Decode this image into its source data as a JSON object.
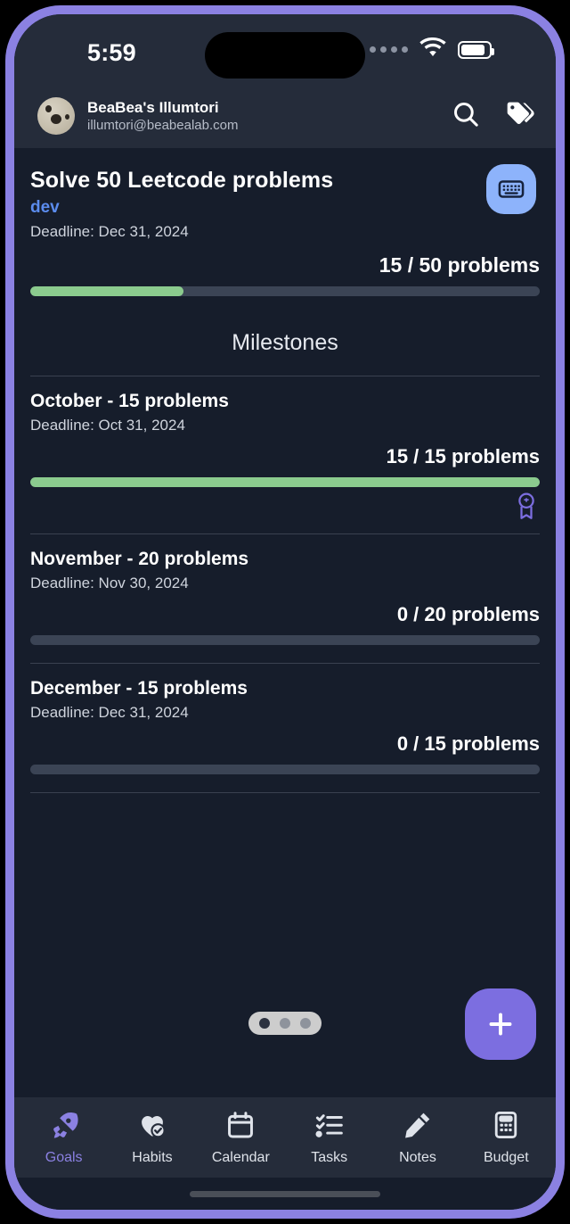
{
  "status_bar": {
    "time": "5:59",
    "signal_icon": "signal-dots-icon",
    "wifi_icon": "wifi-icon",
    "battery_icon": "battery-icon"
  },
  "account_header": {
    "name": "BeaBea's Illumtori",
    "email": "illumtori@beabealab.com",
    "avatar_icon": "avatar",
    "search_icon": "search-icon",
    "tags_icon": "tags-icon"
  },
  "goal": {
    "title": "Solve 50 Leetcode problems",
    "category": "dev",
    "deadline": "Deadline: Dec 31, 2024",
    "progress_label": "15 / 50 problems",
    "progress_percent": 30,
    "type_icon": "keyboard-icon",
    "accent_color": "#5b8cee",
    "progress_color": "#8bcb8e"
  },
  "milestones_section": {
    "title": "Milestones",
    "items": [
      {
        "name": "October - 15 problems",
        "deadline": "Deadline: Oct 31, 2024",
        "progress_label": "15 / 15 problems",
        "progress_percent": 100,
        "badge_icon": "award-medal-icon",
        "completed": true
      },
      {
        "name": "November - 20 problems",
        "deadline": "Deadline: Nov 30, 2024",
        "progress_label": "0 / 20 problems",
        "progress_percent": 0,
        "badge_icon": "",
        "completed": false
      },
      {
        "name": "December - 15 problems",
        "deadline": "Deadline: Dec 31, 2024",
        "progress_label": "0 / 15 problems",
        "progress_percent": 0,
        "badge_icon": "",
        "completed": false
      }
    ]
  },
  "page_indicator": {
    "total": 3,
    "active_index": 0
  },
  "fab": {
    "icon": "plus-icon",
    "color": "#7c6ee0"
  },
  "bottom_nav": {
    "active_color": "#8b81e2",
    "items": [
      {
        "label": "Goals",
        "icon": "rocket-icon",
        "active": true
      },
      {
        "label": "Habits",
        "icon": "heart-check-icon",
        "active": false
      },
      {
        "label": "Calendar",
        "icon": "calendar-icon",
        "active": false
      },
      {
        "label": "Tasks",
        "icon": "checklist-icon",
        "active": false
      },
      {
        "label": "Notes",
        "icon": "pencil-icon",
        "active": false
      },
      {
        "label": "Budget",
        "icon": "calculator-icon",
        "active": false
      }
    ]
  }
}
